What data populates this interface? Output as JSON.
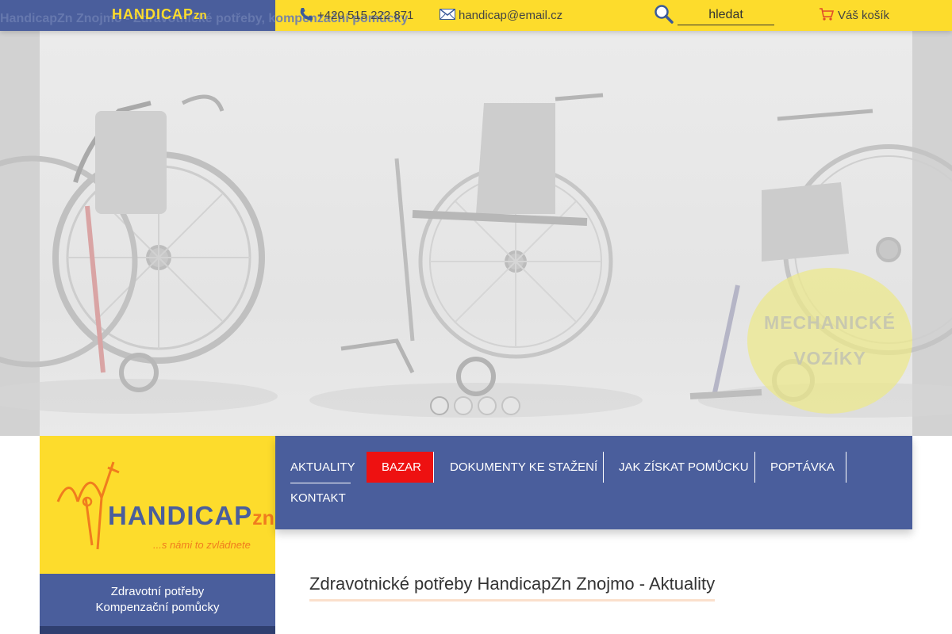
{
  "page": {
    "ghost_title": "HandicapZn Znojmo - Zdravotnické potřeby, kompenzační pomůcky"
  },
  "topbar": {
    "brand_logo": "HANDICAP",
    "brand_logo_suffix": "zn",
    "phone": "+420 515 222 871",
    "email": "handicap@email.cz",
    "search_placeholder": "hledat",
    "cart_label": "Váš košík"
  },
  "slider": {
    "badge_line1": "MECHANICKÉ",
    "badge_line2": "VOZÍKY",
    "dots_count": 4,
    "active_dot": 0
  },
  "sidebar": {
    "logo_word": "HANDICAP",
    "logo_suffix": "zn",
    "logo_tagline": "...s námi to zvládnete",
    "subtitle_line1": "Zdravotní potřeby",
    "subtitle_line2": "Kompenzační pomůcky"
  },
  "nav": {
    "items": [
      {
        "label": "AKTUALITY",
        "state": "current"
      },
      {
        "label": "BAZAR",
        "state": "highlighted"
      },
      {
        "label": "DOKUMENTY KE STAŽENÍ",
        "state": "normal"
      },
      {
        "label": "JAK ZÍSKAT POMŮCKU",
        "state": "normal"
      },
      {
        "label": "POPTÁVKA",
        "state": "normal"
      },
      {
        "label": "KONTAKT",
        "state": "normal"
      }
    ]
  },
  "content": {
    "heading": "Zdravotnické potřeby HandicapZn Znojmo - Aktuality"
  },
  "colors": {
    "yellow": "#fddc2c",
    "blue": "#4a5e9c",
    "red": "#ee1111",
    "orange": "#f07c1e"
  },
  "icons": {
    "phone": "phone-icon",
    "mail": "envelope-icon",
    "search": "magnifier-icon",
    "cart": "cart-icon"
  }
}
